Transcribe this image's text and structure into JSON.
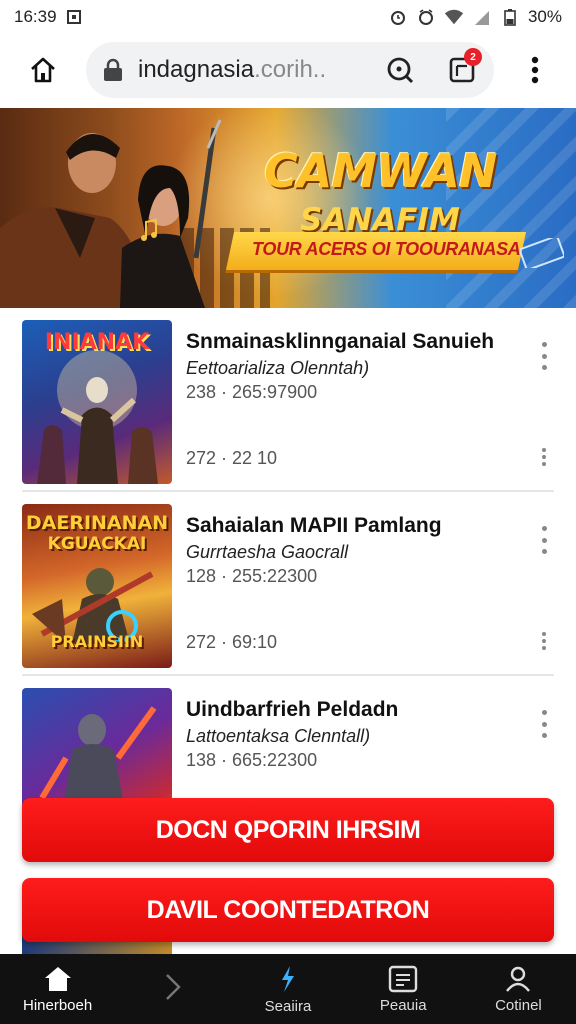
{
  "status_bar": {
    "time": "16:39",
    "battery": "30%"
  },
  "browser": {
    "url_main": "indagnasia",
    "url_dim": ".corih..",
    "tabs_badge": "2"
  },
  "hero": {
    "title": "CAMWAN",
    "subtitle": "SANAFIM",
    "ribbon": "TOUR ACERS OI TOOURANASA"
  },
  "items": [
    {
      "thumb_label": "INIANAK",
      "title": "Snmainasklinnganaial Sanuieh",
      "subtitle": "Eettoarializa Olenntah)",
      "stat": "238 · 265:97900",
      "stat2": "272 · 22 10"
    },
    {
      "thumb_label": "DAERINANAN",
      "thumb_label2": "KGUACKAI",
      "thumb_label3": "PRAINSIIN",
      "title": "Sahaialan MAPII Pamlang",
      "subtitle": "Gurrtaesha Gaocrall",
      "stat": "128 · 255:22300",
      "stat2": "272 · 69:10"
    },
    {
      "title": "Uindbarfrieh Peldadn",
      "subtitle": "Lattoentaksa Clenntall)",
      "stat": "138 · 665:22300"
    }
  ],
  "cta": {
    "primary": "DOCN QPORIN IHRSIM",
    "secondary": "DAVIL COONTEDATRON"
  },
  "bottom_nav": [
    {
      "label": "Hinerboeh",
      "icon": "home-icon"
    },
    {
      "label": "",
      "icon": "chevron-right-icon"
    },
    {
      "label": "Seaiira",
      "icon": "bolt-icon"
    },
    {
      "label": "Peauia",
      "icon": "news-icon"
    },
    {
      "label": "Cotinel",
      "icon": "profile-icon"
    }
  ],
  "colors": {
    "accent_red": "#e8202a",
    "nav_bg": "#111111",
    "hero_gold": "#ffc12a"
  }
}
